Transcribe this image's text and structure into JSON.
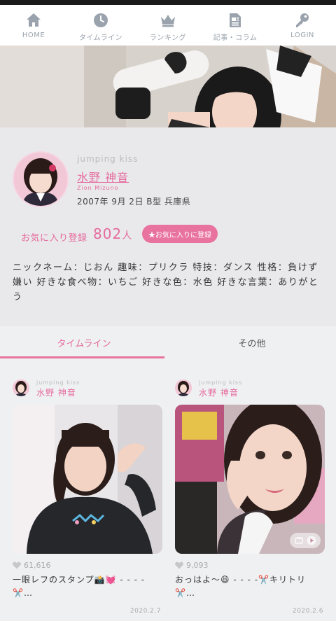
{
  "nav": {
    "items": [
      {
        "label": "HOME",
        "icon": "home-icon"
      },
      {
        "label": "タイムライン",
        "icon": "clock-icon"
      },
      {
        "label": "ランキング",
        "icon": "crown-icon"
      },
      {
        "label": "記事・コラム",
        "icon": "document-icon"
      },
      {
        "label": "LOGIN",
        "icon": "key-icon"
      }
    ]
  },
  "profile": {
    "group": "jumping kiss",
    "name": "水野 神音",
    "romaji": "Zion Mizuno",
    "birth_info": "2007年 9月 2日 B型 兵庫県",
    "fav_label": "お気に入り登録",
    "fav_count": "802",
    "fav_unit": "人",
    "fav_button": "★お気に入りに登録",
    "bio": "ニックネーム：じおん 趣味：プリクラ 特技：ダンス 性格：負けず嫌い 好きな食べ物：いちご 好きな色：水色 好きな言葉：ありがとう"
  },
  "tabs": [
    {
      "label": "タイムライン",
      "active": true
    },
    {
      "label": "その他",
      "active": false
    }
  ],
  "posts": [
    {
      "group": "jumping kiss",
      "member": "水野 神音",
      "likes": "61,616",
      "caption": "一眼レフのスタンプ📸💓 - - - - ✂️…",
      "date": "2020.2.7"
    },
    {
      "group": "jumping kiss",
      "member": "水野 神音",
      "likes": "9,093",
      "caption": "おっはよ〜😆 - - - -✂️キリトリ✂️…",
      "date": "2020.2.6"
    }
  ],
  "colors": {
    "accent": "#e56b9e",
    "button": "#e8739f",
    "profile_bg": "#e9e9eb",
    "feed_bg": "#eff0f2",
    "nav_text": "#9aa3ad"
  }
}
